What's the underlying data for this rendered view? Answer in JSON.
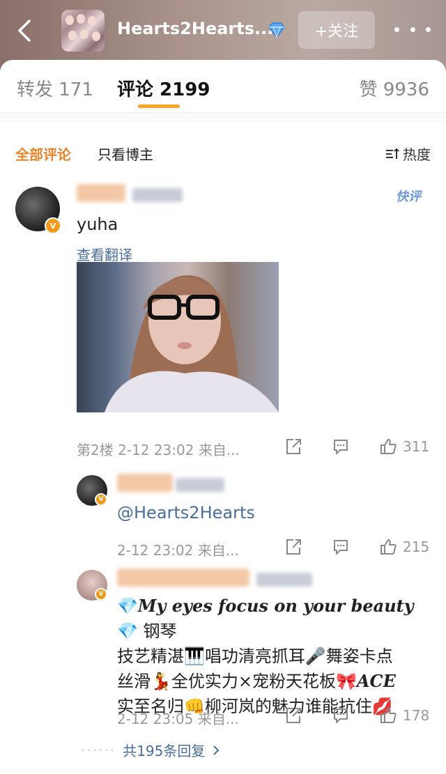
{
  "header": {
    "title": "Hearts2Hearts...",
    "follow_label": "+关注"
  },
  "tabs": [
    {
      "label": "转发 171"
    },
    {
      "label": "评论 2199"
    },
    {
      "label": "赞 9936"
    }
  ],
  "filters": {
    "all": "全部评论",
    "only_author": "只看博主",
    "sort": "热度"
  },
  "comment": {
    "quick_label": "快评",
    "text": "yuha",
    "translate": "查看翻译",
    "floor_meta": "第2楼  2-12 23:02  来自...",
    "likes": "311"
  },
  "reply1": {
    "text": "@Hearts2Hearts",
    "meta": "2-12 23:02  来自...",
    "likes": "215"
  },
  "reply2": {
    "line1_en": "My eyes focus on your beauty",
    "line1_cn": " 钢琴",
    "line2": "技艺精湛🎹唱功清亮抓耳🎤舞姿卡点",
    "line3a": "丝滑💃全优实力×宠粉天花板🎀",
    "line3_en": "ACE",
    "line4": "实至名归👊柳河岚的魅力谁能抗住💋",
    "meta": "2-12 23:05  来自...",
    "likes": "178"
  },
  "replies_link": "共195条回复",
  "colors": {
    "accent": "#f5a623",
    "link": "#4a6d9c",
    "active_filter": "#e8842a",
    "verified": "#f29a1c"
  },
  "icons": [
    "back-arrow-icon",
    "diamond-vip-icon",
    "more-dots-icon",
    "sort-icon",
    "share-icon",
    "comment-icon",
    "like-icon",
    "chevron-right-icon"
  ]
}
